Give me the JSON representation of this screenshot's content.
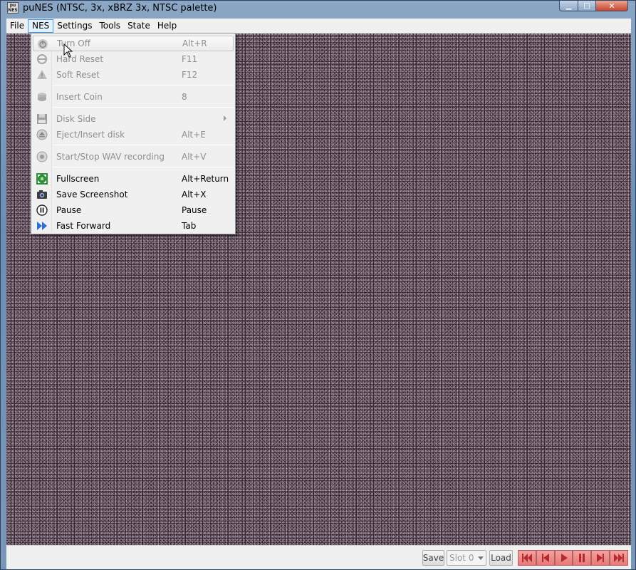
{
  "window": {
    "title": "puNES (NTSC, 3x, xBRZ 3x, NTSC palette)",
    "app_icon_text": "pu\nNES",
    "controls": {
      "minimize": "▁",
      "maximize": "□",
      "close": "✕"
    }
  },
  "menubar": {
    "items": [
      "File",
      "NES",
      "Settings",
      "Tools",
      "State",
      "Help"
    ],
    "active": "NES"
  },
  "nes_menu": {
    "items": [
      {
        "label": "Turn Off",
        "shortcut": "Alt+R",
        "icon": "power-icon",
        "enabled": false
      },
      {
        "label": "Hard Reset",
        "shortcut": "F11",
        "icon": "hard-reset-icon",
        "enabled": false
      },
      {
        "label": "Soft Reset",
        "shortcut": "F12",
        "icon": "warning-icon",
        "enabled": false
      },
      {
        "label": "Insert Coin",
        "shortcut": "8",
        "icon": "coin-icon",
        "enabled": false
      },
      {
        "label": "Disk Side",
        "shortcut": "",
        "icon": "disk-icon",
        "enabled": false,
        "submenu": true
      },
      {
        "label": "Eject/Insert disk",
        "shortcut": "Alt+E",
        "icon": "eject-icon",
        "enabled": false
      },
      {
        "label": "Start/Stop WAV recording",
        "shortcut": "Alt+V",
        "icon": "record-icon",
        "enabled": false
      },
      {
        "label": "Fullscreen",
        "shortcut": "Alt+Return",
        "icon": "fullscreen-icon",
        "enabled": true
      },
      {
        "label": "Save Screenshot",
        "shortcut": "Alt+X",
        "icon": "camera-icon",
        "enabled": true
      },
      {
        "label": "Pause",
        "shortcut": "Pause",
        "icon": "pause-icon",
        "enabled": true
      },
      {
        "label": "Fast Forward",
        "shortcut": "Tab",
        "icon": "fast-forward-icon",
        "enabled": true
      }
    ]
  },
  "statusbar": {
    "save_label": "Save",
    "slot_value": "Slot 0",
    "load_label": "Load",
    "controls": [
      "rewind-to-start-icon",
      "step-back-icon",
      "play-icon",
      "pause-icon",
      "step-forward-icon",
      "fast-forward-end-icon"
    ]
  },
  "colors": {
    "menu_bg": "#f0f0f0",
    "disabled_text": "#8d8d8d",
    "control_red": "#e77a7a",
    "screen_noise": "#2b1f28"
  }
}
